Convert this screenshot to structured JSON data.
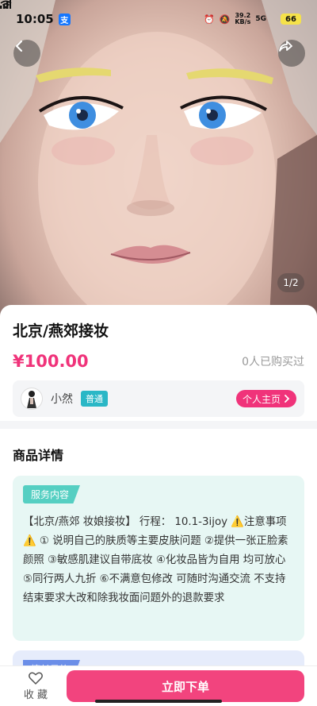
{
  "status_bar": {
    "time": "10:05",
    "app_badge": "支",
    "net_speed_value": "39.2",
    "net_speed_unit": "KB/s",
    "network": "5G",
    "battery": "66"
  },
  "gallery": {
    "pager": "1/2",
    "subject": "portrait-photo"
  },
  "product": {
    "title": "北京/燕郊接妆",
    "price": "¥100.00",
    "sold": "0人已购买过"
  },
  "seller": {
    "name": "小然",
    "tag": "普通",
    "home_label": "个人主页"
  },
  "details": {
    "section_title": "商品详情",
    "service_tag": "服务内容",
    "service_text": "【北京/燕郊 妆娘接妆】 行程： 10.1-3ijoy ⚠️注意事项⚠️ ① 说明自己的肤质等主要皮肤问题 ②提供一张正脸素颜照 ③敏感肌建议自带底妆 ④化妆品皆为自用 均可放心 ⑤同行两人九折 ⑥不满意包修改 可随时沟通交流 不支持结束要求大改和除我妆面问题外的退款要求",
    "style_tag": "擅长风格"
  },
  "bottom_bar": {
    "favorite_label": "收 藏",
    "buy_label": "立即下单"
  },
  "colors": {
    "accent_pink": "#f0337a",
    "service_bg": "#e7f7f4",
    "service_tag": "#55cfc2",
    "style_tag": "#6b8ee8",
    "seller_tag": "#2ab7c6"
  }
}
